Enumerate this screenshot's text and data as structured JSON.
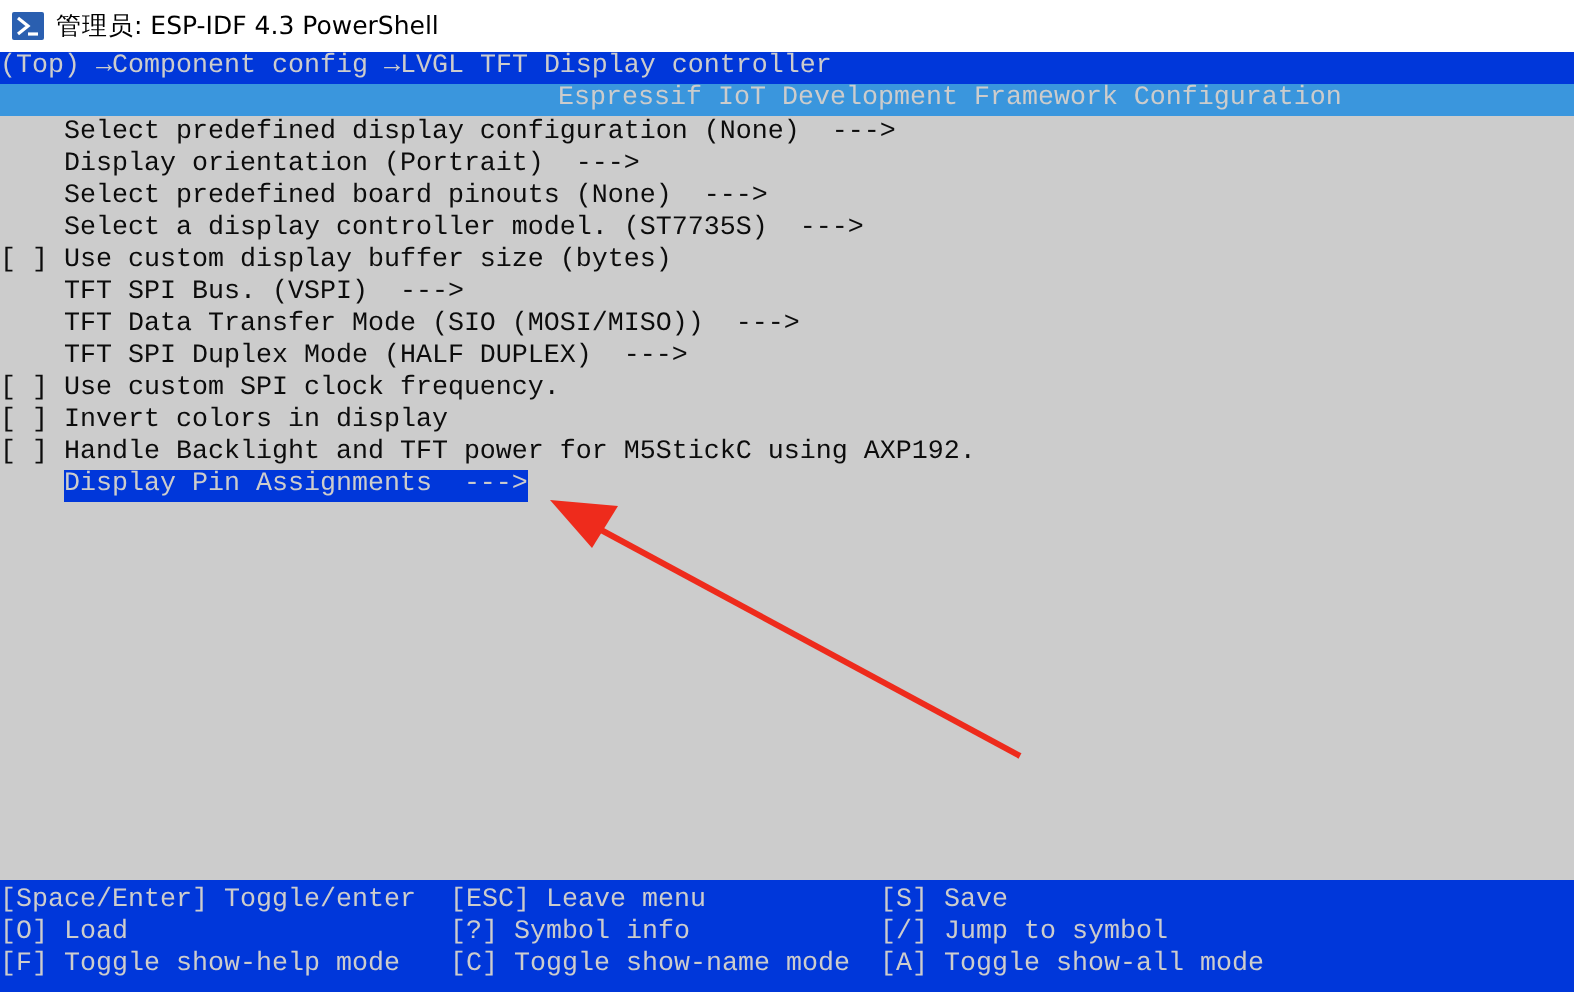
{
  "window": {
    "title": "管理员: ESP-IDF 4.3 PowerShell"
  },
  "breadcrumb": "(Top) →Component config →LVGL TFT Display controller",
  "header": "Espressif IoT Development Framework Configuration",
  "menu": [
    {
      "kind": "submenu",
      "label": "Select predefined display configuration (None)  --->",
      "selected": false
    },
    {
      "kind": "submenu",
      "label": "Display orientation (Portrait)  --->",
      "selected": false
    },
    {
      "kind": "submenu",
      "label": "Select predefined board pinouts (None)  --->",
      "selected": false
    },
    {
      "kind": "submenu",
      "label": "Select a display controller model. (ST7735S)  --->",
      "selected": false
    },
    {
      "kind": "checkbox",
      "box": "[ ]",
      "checked": false,
      "label": "Use custom display buffer size (bytes)",
      "selected": false
    },
    {
      "kind": "submenu",
      "label": "TFT SPI Bus. (VSPI)  --->",
      "selected": false
    },
    {
      "kind": "submenu",
      "label": "TFT Data Transfer Mode (SIO (MOSI/MISO))  --->",
      "selected": false
    },
    {
      "kind": "submenu",
      "label": "TFT SPI Duplex Mode (HALF DUPLEX)  --->",
      "selected": false
    },
    {
      "kind": "checkbox",
      "box": "[ ]",
      "checked": false,
      "label": "Use custom SPI clock frequency.",
      "selected": false
    },
    {
      "kind": "checkbox",
      "box": "[ ]",
      "checked": false,
      "label": "Invert colors in display",
      "selected": false
    },
    {
      "kind": "checkbox",
      "box": "[ ]",
      "checked": false,
      "label": "Handle Backlight and TFT power for M5StickC using AXP192.",
      "selected": false
    },
    {
      "kind": "submenu",
      "label": "Display Pin Assignments  --->",
      "selected": true
    }
  ],
  "shortcuts": [
    [
      "[Space/Enter] Toggle/enter",
      "[ESC] Leave menu",
      "[S] Save"
    ],
    [
      "[O] Load",
      "[?] Symbol info",
      "[/] Jump to symbol"
    ],
    [
      "[F] Toggle show-help mode",
      "[C] Toggle show-name mode",
      "[A] Toggle show-all mode"
    ]
  ]
}
